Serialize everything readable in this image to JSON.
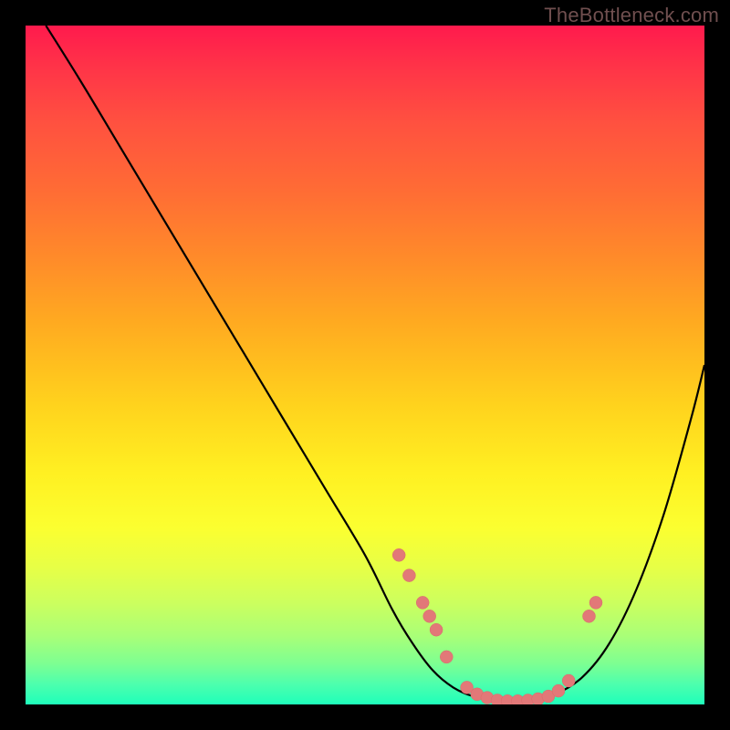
{
  "watermark": "TheBottleneck.com",
  "colors": {
    "dot": "#e27878",
    "curve": "#000000"
  },
  "chart_data": {
    "type": "line",
    "title": "",
    "xlabel": "",
    "ylabel": "",
    "xlim": [
      0,
      100
    ],
    "ylim": [
      0,
      100
    ],
    "series": [
      {
        "name": "curve",
        "x": [
          3,
          8,
          14,
          20,
          26,
          32,
          38,
          44,
          50,
          54,
          57,
          60,
          63,
          66,
          70,
          74,
          78,
          82,
          86,
          90,
          94,
          98,
          100
        ],
        "y": [
          100,
          92,
          82,
          72,
          62,
          52,
          42,
          32,
          22,
          14,
          9,
          5,
          2.5,
          1.2,
          0.6,
          0.6,
          1.5,
          4,
          9,
          17,
          28,
          42,
          50
        ]
      }
    ],
    "scatter_points": [
      {
        "x": 55,
        "y": 22
      },
      {
        "x": 56.5,
        "y": 19
      },
      {
        "x": 58.5,
        "y": 15
      },
      {
        "x": 59.5,
        "y": 13
      },
      {
        "x": 60.5,
        "y": 11
      },
      {
        "x": 62,
        "y": 7
      },
      {
        "x": 65,
        "y": 2.5
      },
      {
        "x": 66.5,
        "y": 1.5
      },
      {
        "x": 68,
        "y": 1.0
      },
      {
        "x": 69.5,
        "y": 0.6
      },
      {
        "x": 71,
        "y": 0.5
      },
      {
        "x": 72.5,
        "y": 0.5
      },
      {
        "x": 74,
        "y": 0.6
      },
      {
        "x": 75.5,
        "y": 0.8
      },
      {
        "x": 77,
        "y": 1.2
      },
      {
        "x": 78.5,
        "y": 2.0
      },
      {
        "x": 80,
        "y": 3.5
      },
      {
        "x": 83,
        "y": 13
      },
      {
        "x": 84,
        "y": 15
      }
    ]
  }
}
